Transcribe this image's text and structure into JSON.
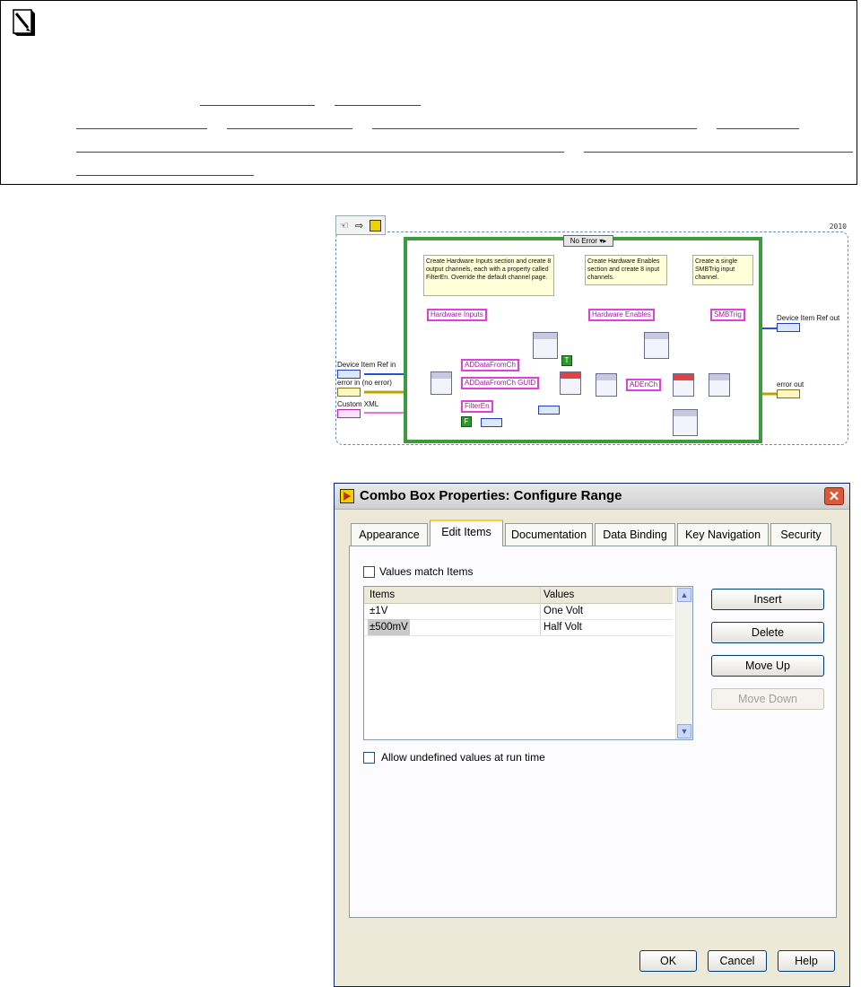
{
  "block_diagram": {
    "year": "2010",
    "case_selector": "No Error",
    "comments": [
      "Create Hardware Inputs section and create 8 output channels, each with a property called FilterEn.  Override the default channel page.",
      "Create Hardware Enables section and create 8 input channels.",
      "Create a single SMBTrig input channel."
    ],
    "strings": {
      "hw_inputs": "Hardware Inputs",
      "ad_data_from_ch": "ADDataFromCh",
      "ad_data_guid": "ADDataFromCh GUID",
      "filter_en": "FilterEn",
      "hw_enables": "Hardware Enables",
      "ad_en_ch": "ADEnCh",
      "smb_trig": "SMBTrig"
    },
    "controls": {
      "device_ref_in": "Device Item Ref in",
      "error_in": "error in (no error)",
      "custom_xml": "Custom XML"
    },
    "indicators": {
      "device_ref_out": "Device Item Ref out",
      "error_out": "error out"
    },
    "constants": {
      "true_const": "T",
      "false_const": "F"
    }
  },
  "dialog": {
    "title": "Combo Box Properties: Configure Range",
    "tabs": [
      "Appearance",
      "Edit Items",
      "Documentation",
      "Data Binding",
      "Key Navigation",
      "Security"
    ],
    "active_tab": "Edit Items",
    "values_match_label": "Values match Items",
    "values_match_checked": false,
    "table": {
      "columns": [
        "Items",
        "Values"
      ],
      "rows": [
        {
          "item": "±1V",
          "value": "One Volt"
        },
        {
          "item": "±500mV",
          "value": "Half Volt"
        }
      ]
    },
    "buttons": {
      "insert": "Insert",
      "delete": "Delete",
      "move_up": "Move Up",
      "move_down": "Move Down"
    },
    "allow_undefined_label": "Allow undefined values at run time",
    "allow_undefined_checked": false,
    "footer": {
      "ok": "OK",
      "cancel": "Cancel",
      "help": "Help"
    }
  }
}
